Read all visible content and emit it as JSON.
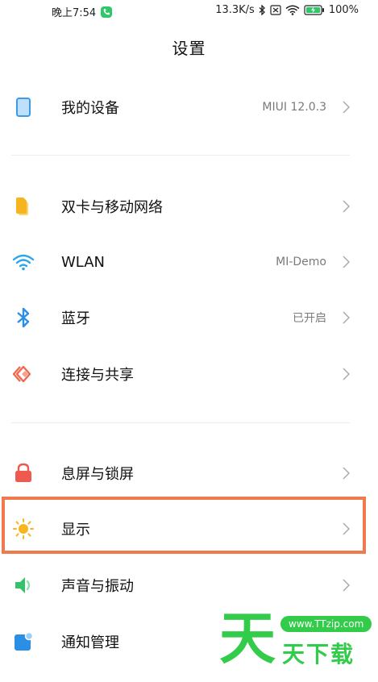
{
  "status_bar": {
    "time": "晚上7:54",
    "network_speed": "13.3K/s",
    "battery": "100%",
    "icons": [
      "phone-call-icon",
      "bluetooth-icon",
      "sim-disabled-icon",
      "wifi-icon",
      "battery-charging-icon"
    ]
  },
  "page": {
    "title": "设置"
  },
  "settings": {
    "my_device": {
      "label": "我的设备",
      "value": "MIUI 12.0.3",
      "icon": "device-icon",
      "color": "#3a9bea"
    },
    "sim": {
      "label": "双卡与移动网络",
      "icon": "sim-card-icon",
      "color": "#f6b51e"
    },
    "wlan": {
      "label": "WLAN",
      "value": "MI-Demo",
      "icon": "wifi-icon",
      "color": "#2aa7e8"
    },
    "bluetooth": {
      "label": "蓝牙",
      "value": "已开启",
      "icon": "bluetooth-icon",
      "color": "#2c8fe6"
    },
    "connection": {
      "label": "连接与共享",
      "icon": "connection-share-icon",
      "color": "#ee6a4f"
    },
    "lockscreen": {
      "label": "息屏与锁屏",
      "icon": "lock-icon",
      "color": "#ee5a4f"
    },
    "display": {
      "label": "显示",
      "icon": "sun-icon",
      "color": "#f7b51e"
    },
    "sound": {
      "label": "声音与振动",
      "icon": "speaker-icon",
      "color": "#34c36a"
    },
    "notifications": {
      "label": "通知管理",
      "icon": "notification-icon",
      "color": "#2c8fe6"
    }
  },
  "highlight_color": "#ef7a4e",
  "watermark": {
    "big_char": "天",
    "domain": "www.TTzip.com",
    "subtitle": "天下载",
    "color": "#33cc4a"
  }
}
